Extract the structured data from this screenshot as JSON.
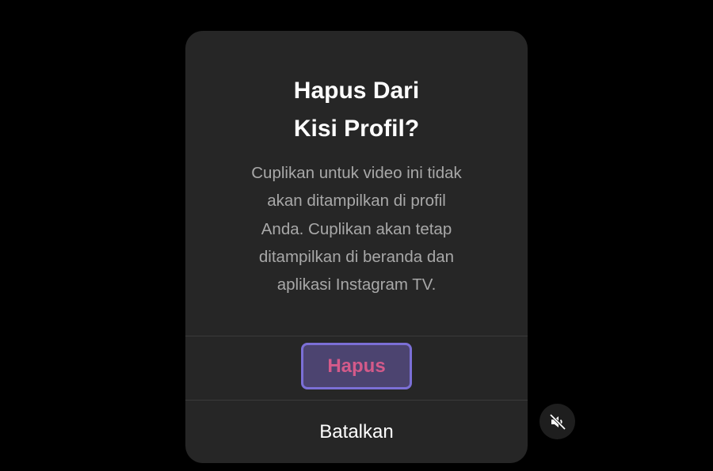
{
  "dialog": {
    "title_lines": [
      "Hapus Dari",
      "Kisi Profil?"
    ],
    "body_lines": [
      "Cuplikan untuk video ini tidak",
      "akan ditampilkan di profil",
      "Anda. Cuplikan akan tetap",
      "ditampilkan di beranda dan",
      "aplikasi Instagram TV."
    ],
    "delete_label": "Hapus",
    "cancel_label": "Batalkan"
  },
  "icons": {
    "mute": "speaker-muted-icon"
  },
  "colors": {
    "background": "#000000",
    "dialog_bg": "#262626",
    "delete_text": "#d45a8a",
    "focus_ring": "#7b6fd6"
  }
}
